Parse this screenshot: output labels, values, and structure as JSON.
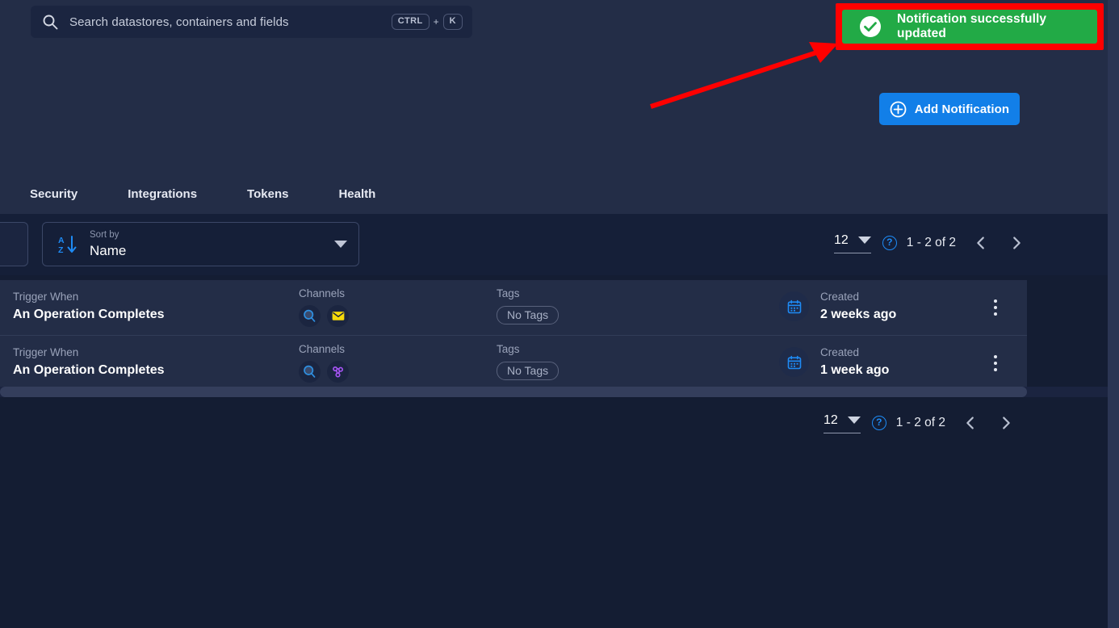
{
  "search": {
    "icon": "search-icon",
    "placeholder": "Search datastores, containers and fields",
    "key_modifier": "CTRL",
    "key_plus": "+",
    "key_main": "K"
  },
  "toast": {
    "icon": "check-circle-icon",
    "message": "Notification successfully updated",
    "background_color": "#22aa46",
    "annotation_border_color": "#ff0000"
  },
  "annotation": {
    "arrow_color": "#ff0000"
  },
  "actions": {
    "add_notification_label": "Add Notification",
    "add_notification_icon": "plus-circle-icon",
    "add_notification_color": "#127fe8"
  },
  "tabs": [
    {
      "label": "Security"
    },
    {
      "label": "Integrations"
    },
    {
      "label": "Tokens"
    },
    {
      "label": "Health"
    }
  ],
  "toolbar": {
    "sort": {
      "icon": "sort-alpha-down-icon",
      "label": "Sort by",
      "value": "Name",
      "chevron": "chevron-down-icon"
    }
  },
  "pagination": {
    "page_size": "12",
    "page_size_chevron": "chevron-down-icon",
    "help_icon": "help-circle-icon",
    "help_glyph": "?",
    "range": "1 - 2 of 2",
    "prev_icon": "chevron-left-icon",
    "next_icon": "chevron-right-icon"
  },
  "table": {
    "columns": {
      "trigger": "Trigger When",
      "channels": "Channels",
      "tags": "Tags",
      "created": "Created"
    },
    "rows": [
      {
        "trigger_label": "Trigger When",
        "trigger_value": "An Operation Completes",
        "channels_label": "Channels",
        "channels": [
          {
            "icon": "search-channel-icon",
            "color": "#2e8fe0"
          },
          {
            "icon": "email-channel-icon",
            "color": "#f5d90a"
          }
        ],
        "tags_label": "Tags",
        "tags_value": "No Tags",
        "created_label": "Created",
        "created_value": "2 weeks ago",
        "created_icon": "calendar-icon",
        "menu_icon": "kebab-menu-icon"
      },
      {
        "trigger_label": "Trigger When",
        "trigger_value": "An Operation Completes",
        "channels_label": "Channels",
        "channels": [
          {
            "icon": "search-channel-icon",
            "color": "#2e8fe0"
          },
          {
            "icon": "webhook-channel-icon",
            "color": "#a855f7"
          }
        ],
        "tags_label": "Tags",
        "tags_value": "No Tags",
        "created_label": "Created",
        "created_value": "1 week ago",
        "created_icon": "calendar-icon",
        "menu_icon": "kebab-menu-icon"
      }
    ]
  },
  "theme": {
    "page_background": "#141d33",
    "panel_background": "#232d47",
    "toolbar_background": "#151f38",
    "accent_blue": "#1e8bf5"
  }
}
